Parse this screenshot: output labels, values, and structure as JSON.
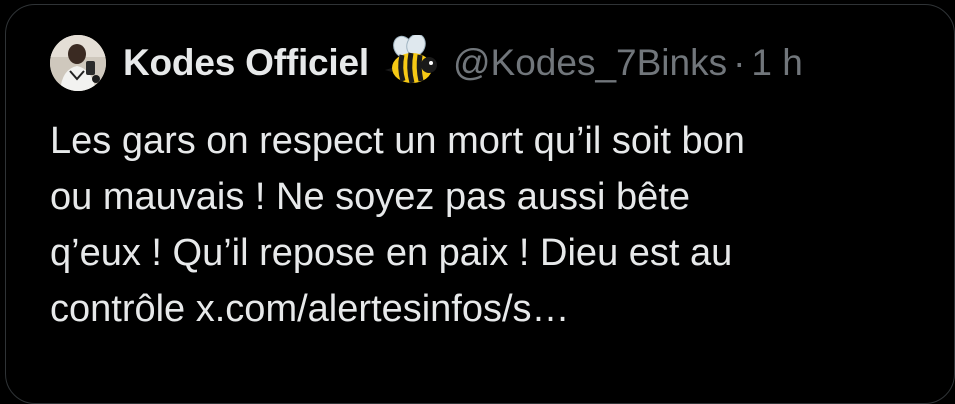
{
  "tweet": {
    "author": {
      "display_name": "Kodes Officiel",
      "badge_emoji": "bee-icon",
      "handle": "@Kodes_7Binks",
      "separator": "·",
      "time": "1 h"
    },
    "text_lines": [
      "Les gars on respect un mort qu’il soit bon",
      "ou mauvais ! Ne soyez pas aussi bête",
      "q’eux ! Qu’il repose en paix ! Dieu est au",
      "contrôle x.com/alertesinfos/s…"
    ]
  },
  "colors": {
    "background": "#000000",
    "primary_text": "#e7e9ea",
    "secondary_text": "#71767b",
    "border": "#2f3336"
  }
}
